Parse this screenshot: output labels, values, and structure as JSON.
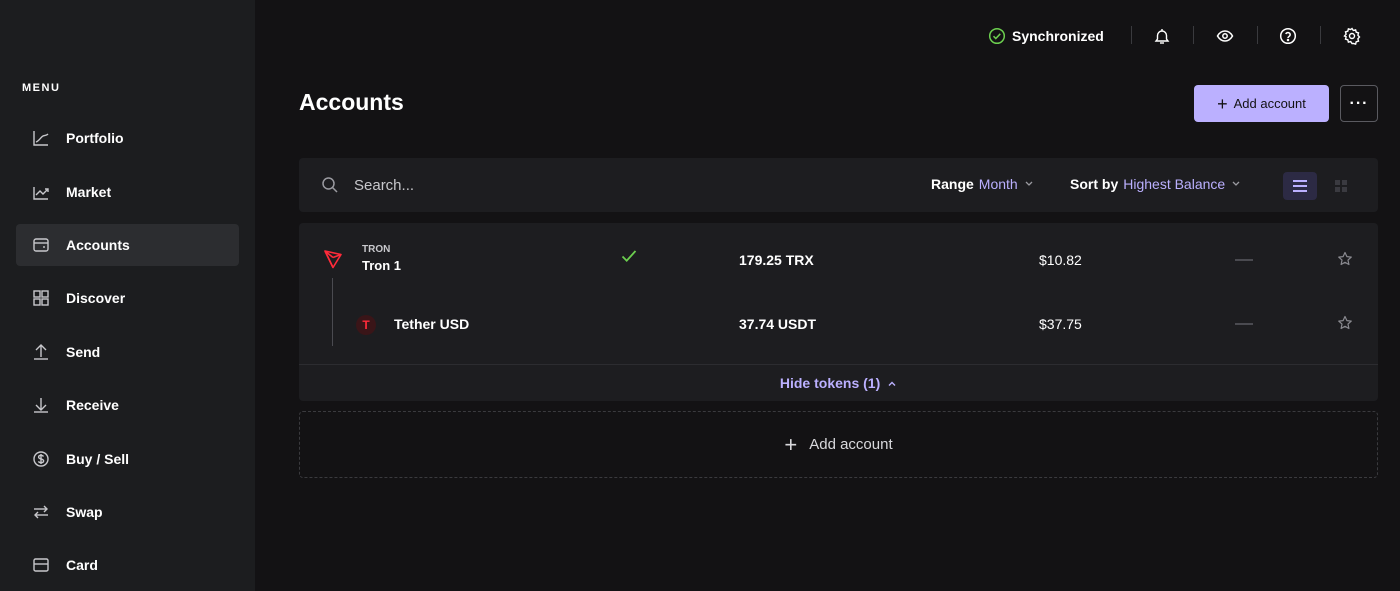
{
  "topbar": {
    "sync_label": "Synchronized",
    "sync_color": "#6ccf4f"
  },
  "sidebar": {
    "menu_label": "MENU",
    "items": [
      {
        "label": "Portfolio",
        "icon": "chart-line-icon"
      },
      {
        "label": "Market",
        "icon": "trend-icon"
      },
      {
        "label": "Accounts",
        "icon": "wallet-icon",
        "active": true
      },
      {
        "label": "Discover",
        "icon": "grid-icon"
      },
      {
        "label": "Send",
        "icon": "arrow-up-icon"
      },
      {
        "label": "Receive",
        "icon": "arrow-down-icon"
      },
      {
        "label": "Buy / Sell",
        "icon": "dollar-circle-icon"
      },
      {
        "label": "Swap",
        "icon": "swap-icon"
      },
      {
        "label": "Card",
        "icon": "card-icon"
      }
    ]
  },
  "main": {
    "title": "Accounts",
    "add_account_button": "Add account",
    "more_button": "···",
    "search_placeholder": "Search...",
    "range_label": "Range",
    "range_value": "Month",
    "sort_label": "Sort by",
    "sort_value": "Highest Balance",
    "accent_color": "#bbb0ff"
  },
  "accounts": [
    {
      "network": "TRON",
      "name": "Tron 1",
      "balance": "179.25 TRX",
      "fiat": "$10.82",
      "synced": true,
      "tokens": [
        {
          "name": "Tether USD",
          "badge": "T",
          "balance": "37.74 USDT",
          "fiat": "$37.75"
        }
      ]
    }
  ],
  "hide_tokens_label": "Hide tokens (1)",
  "add_account_row": "Add account"
}
